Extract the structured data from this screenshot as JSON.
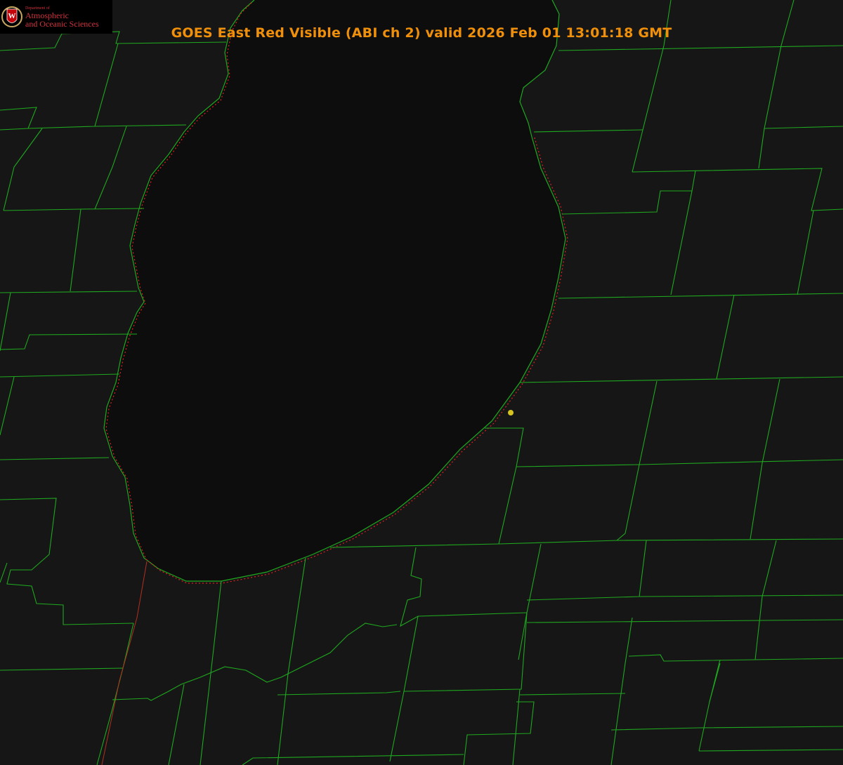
{
  "header": {
    "title": "GOES East Red Visible (ABI ch 2) valid 2026 Feb 01 13:01:18 GMT"
  },
  "logo": {
    "department_label": "Department of",
    "line1": "Atmospheric",
    "line2": "and Oceanic Sciences",
    "letter": "W"
  },
  "colors": {
    "background": "#161616",
    "lake": "#0d0d0d",
    "boundaries": "#1fa81f",
    "shoreline": "#e02020",
    "title": "#f0900a",
    "marker": "#d8c41e",
    "logo_red": "#d2323c"
  },
  "map": {
    "feature": "lake",
    "marker_icon": "station-dot-icon"
  }
}
